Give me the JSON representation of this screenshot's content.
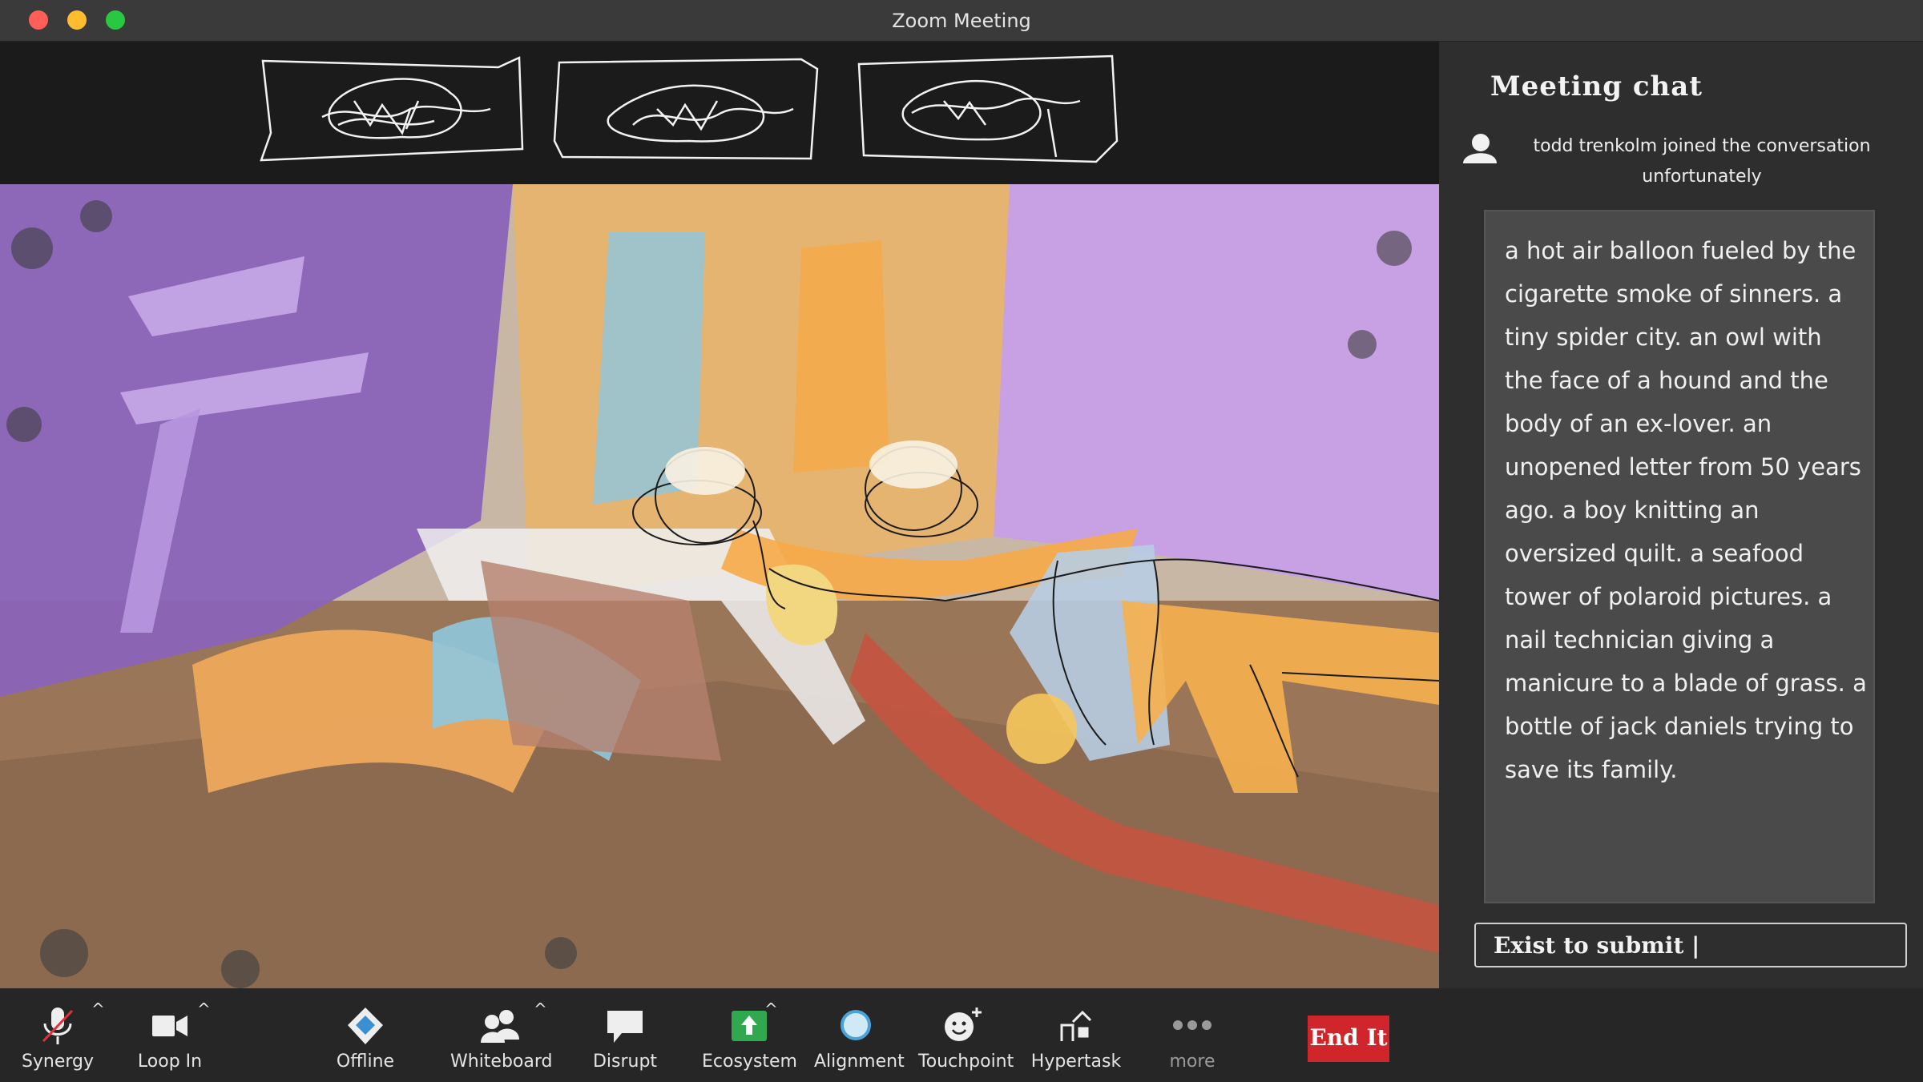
{
  "window": {
    "title": "Zoom Meeting"
  },
  "chat": {
    "title": "Meeting chat",
    "join_line1": "todd trenkolm  joined the conversation",
    "join_line2": "unfortunately",
    "message": "a hot air balloon fueled by the cigarette smoke of sinners. a tiny spider city. an owl with the face of a hound and the body of an ex-lover. an unopened letter from 50 years ago. a boy knitting an oversized quilt. a seafood tower of polaroid pictures. a nail technician giving a manicure to a blade of grass. a bottle of jack daniels trying to save its family.",
    "input_value": "Exist to submit |"
  },
  "toolbar": {
    "synergy": "Synergy",
    "loop_in": "Loop In",
    "offline": "Offline",
    "whiteboard": "Whiteboard",
    "disrupt": "Disrupt",
    "ecosystem": "Ecosystem",
    "alignment": "Alignment",
    "touchpoint": "Touchpoint",
    "hypertask": "Hypertask",
    "more": "more",
    "end": "End It",
    "caret": "^"
  },
  "colors": {
    "end_button": "#d0262b",
    "ecosystem_icon": "#2fa84f"
  }
}
